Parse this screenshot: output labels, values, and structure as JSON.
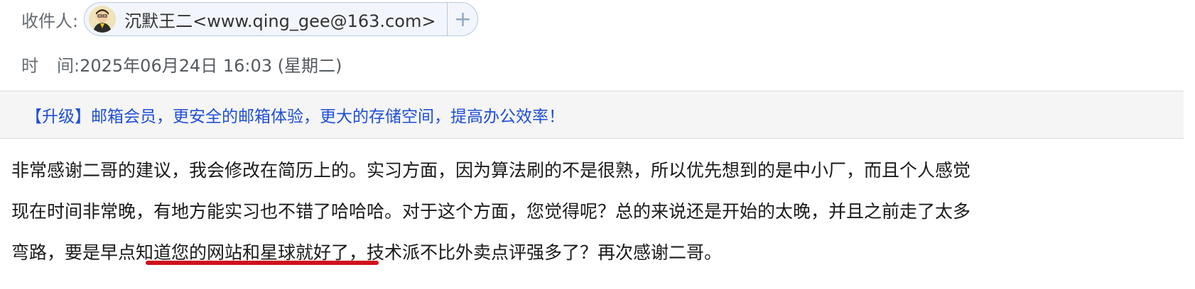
{
  "header": {
    "recipient_label": "收件人:",
    "recipient": {
      "display": "沉默王二<www.qing_gee@163.com>",
      "add_icon": "plus-icon",
      "avatar_icon": "avatar-icon"
    },
    "time_label_a": "时",
    "time_label_b": "间:",
    "time_value": "2025年06月24日 16:03 (星期二)"
  },
  "banner": {
    "text": "【升级】邮箱会员，更安全的邮箱体验，更大的存储空间，提高办公效率！",
    "color": "#1f4fd6"
  },
  "body": {
    "lines": [
      "非常感谢二哥的建议，我会修改在简历上的。实习方面，因为算法刷的不是很熟，所以优先想到的是中小厂，而且个人感觉",
      "现在时间非常晚，有地方能实习也不错了哈哈哈。对于这个方面，您觉得呢？总的来说还是开始的太晚，并且之前走了太多",
      "弯路，要是早点知道您的网站和星球就好了，技术派不比外卖点评强多了？再次感谢二哥。"
    ],
    "annotation_color": "#d0101c"
  }
}
